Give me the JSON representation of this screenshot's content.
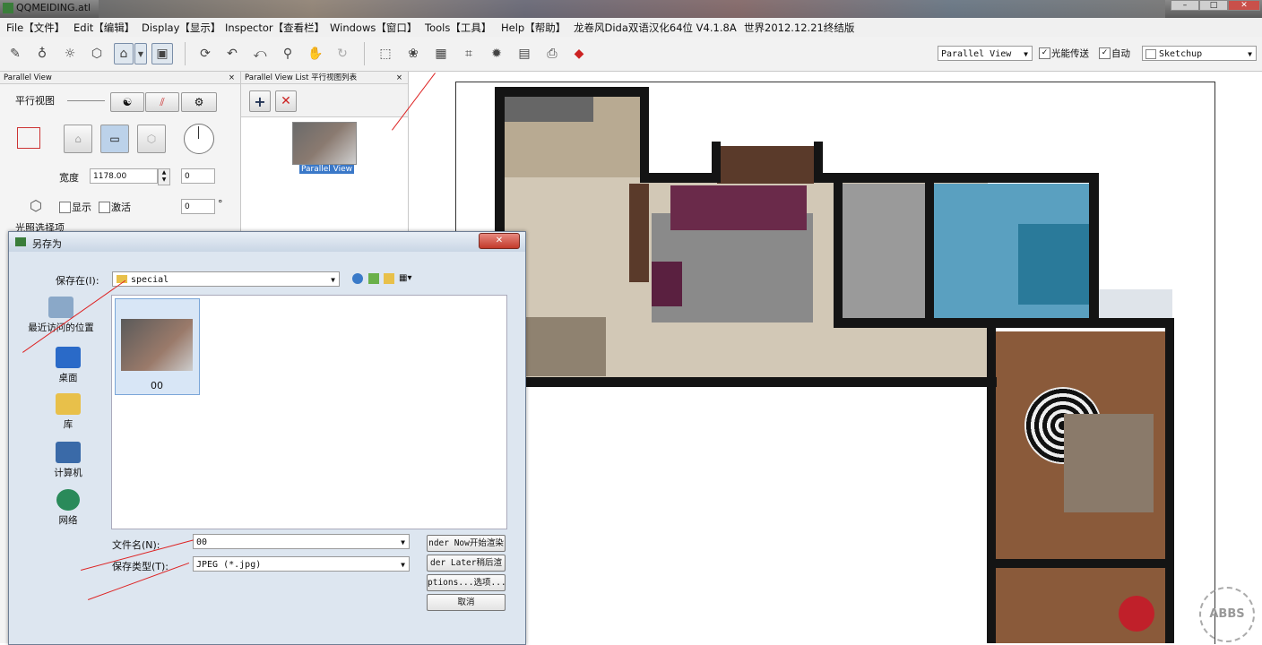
{
  "window": {
    "title": "QQMEIDING.atl"
  },
  "menu": [
    "File【文件】",
    "Edit【编辑】",
    "Display【显示】",
    "Inspector【查看栏】",
    "Windows【窗口】",
    "Tools【工具】",
    "Help【帮助】",
    "龙卷风Dida双语汉化64位 V4.1.8A",
    "世界2012.12.21终结版"
  ],
  "toolbar": {
    "view_select": "Parallel View",
    "check1_label": "光能传送",
    "check2_label": "自动",
    "style_select": "Sketchup"
  },
  "left_panel": {
    "title": "Parallel View",
    "section": "平行视图",
    "width_label": "宽度",
    "width_value": "1178.00",
    "width_extra": "0",
    "show_label": "显示",
    "activate_label": "激活",
    "angle_value": "0",
    "angle_unit": "°",
    "lighting_label": "光照选择项"
  },
  "list_panel": {
    "title": "Parallel View List 平行视图列表",
    "item_label": "Parallel View"
  },
  "dialog": {
    "title": "另存为",
    "save_in_label": "保存在(I):",
    "save_in_value": "special",
    "places": [
      "最近访问的位置",
      "桌面",
      "库",
      "计算机",
      "网络"
    ],
    "file_label": "00",
    "filename_label": "文件名(N):",
    "filename_value": "00",
    "filetype_label": "保存类型(T):",
    "filetype_value": "JPEG (*.jpg)",
    "btn_render_now": "nder Now开始渲染",
    "btn_render_later": "der Later稍后渲",
    "btn_options": "ptions...选项...",
    "btn_cancel": "取消"
  },
  "watermark": "ABBS"
}
